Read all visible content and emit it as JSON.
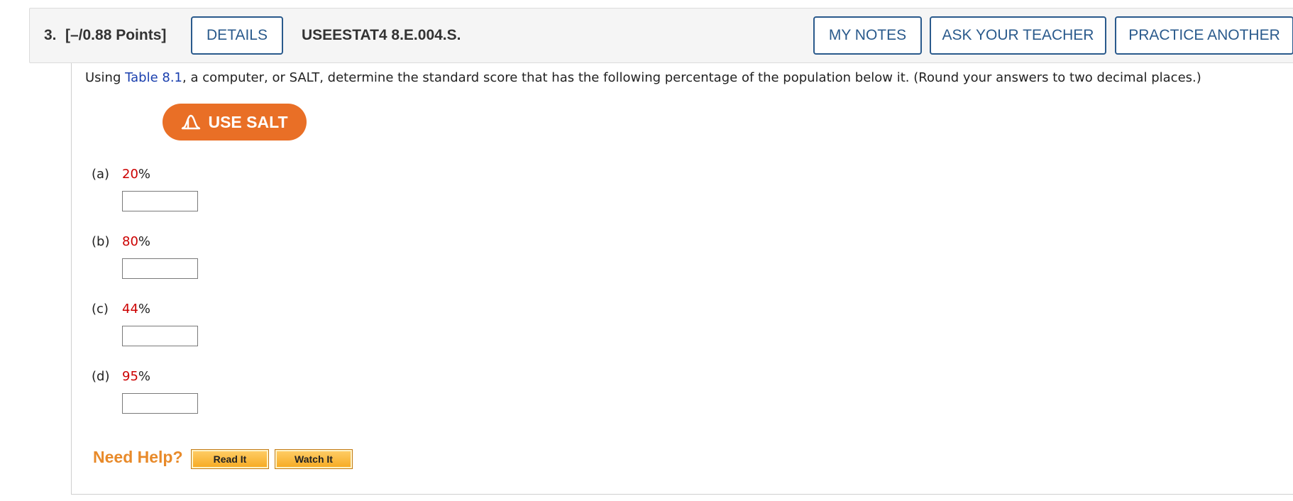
{
  "header": {
    "question_number": "3.",
    "points": "[–/0.88 Points]",
    "details_label": "DETAILS",
    "problem_code": "USEESTAT4 8.E.004.S.",
    "my_notes_label": "MY NOTES",
    "ask_teacher_label": "ASK YOUR TEACHER",
    "practice_another_label": "PRACTICE ANOTHER"
  },
  "question": {
    "prompt_before_link": "Using ",
    "table_link": "Table 8.1",
    "prompt_after_link": ", a computer, or SALT, determine the standard score that has the following percentage of the population below it. (Round your answers to two decimal places.)",
    "salt_button_label": "USE SALT",
    "salt_icon": "bell-curve-icon",
    "parts": [
      {
        "label": "(a)",
        "value": "20",
        "unit": "%",
        "answer": ""
      },
      {
        "label": "(b)",
        "value": "80",
        "unit": "%",
        "answer": ""
      },
      {
        "label": "(c)",
        "value": "44",
        "unit": "%",
        "answer": ""
      },
      {
        "label": "(d)",
        "value": "95",
        "unit": "%",
        "answer": ""
      }
    ]
  },
  "help": {
    "title": "Need Help?",
    "read_it_label": "Read It",
    "watch_it_label": "Watch It"
  },
  "colors": {
    "header_button": "#2a5a8c",
    "link": "#1a3fae",
    "salt_button": "#e96f26",
    "given_value": "#cc0000",
    "need_help": "#e88a2a",
    "help_button": "#f6a91f"
  }
}
